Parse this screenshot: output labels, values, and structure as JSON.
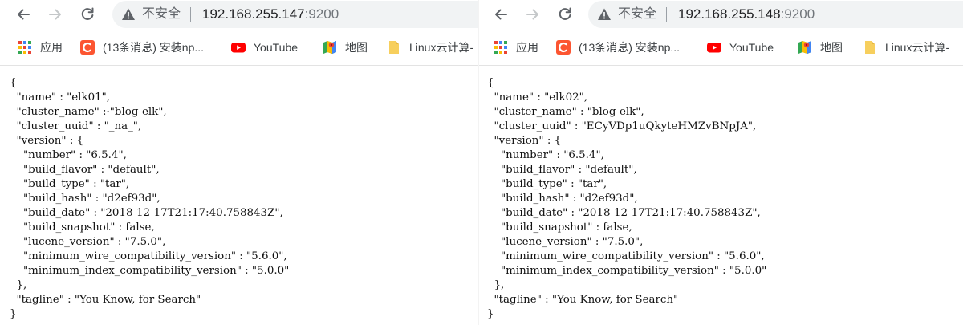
{
  "colors": {
    "toolbar_bg": "#ffffff",
    "omnibox_bg": "#f1f3f4",
    "icon_gray": "#5f6368",
    "disabled_gray": "#c4c7c9",
    "youtube_red": "#ff0000",
    "csdn_orange": "#fc5531",
    "folder_yellow": "#f7cf5d"
  },
  "left": {
    "nav": {
      "back_icon": "back-arrow-icon",
      "forward_icon": "forward-arrow-icon",
      "reload_icon": "reload-icon"
    },
    "address": {
      "security_label": "不安全",
      "host": "192.168.255.147",
      "port": ":9200"
    },
    "bookmarks": [
      {
        "icon": "apps-grid-icon",
        "label": "应用"
      },
      {
        "icon": "csdn-icon",
        "label": "(13条消息) 安装np..."
      },
      {
        "icon": "youtube-icon",
        "label": "YouTube"
      },
      {
        "icon": "maps-icon",
        "label": "地图"
      },
      {
        "icon": "folder-icon",
        "label": "Linux云计算-"
      }
    ],
    "json_body": "{\n  \"name\" : \"elk01\",\n  \"cluster_name\" :·\"blog-elk\",\n  \"cluster_uuid\" : \"_na_\",\n  \"version\" : {\n    \"number\" : \"6.5.4\",\n    \"build_flavor\" : \"default\",\n    \"build_type\" : \"tar\",\n    \"build_hash\" : \"d2ef93d\",\n    \"build_date\" : \"2018-12-17T21:17:40.758843Z\",\n    \"build_snapshot\" : false,\n    \"lucene_version\" : \"7.5.0\",\n    \"minimum_wire_compatibility_version\" : \"5.6.0\",\n    \"minimum_index_compatibility_version\" : \"5.0.0\"\n  },\n  \"tagline\" : \"You Know, for Search\"\n}"
  },
  "right": {
    "nav": {
      "back_icon": "back-arrow-icon",
      "forward_icon": "forward-arrow-icon",
      "reload_icon": "reload-icon"
    },
    "address": {
      "security_label": "不安全",
      "host": "192.168.255.148",
      "port": ":9200"
    },
    "bookmarks": [
      {
        "icon": "apps-grid-icon",
        "label": "应用"
      },
      {
        "icon": "csdn-icon",
        "label": "(13条消息) 安装np..."
      },
      {
        "icon": "youtube-icon",
        "label": "YouTube"
      },
      {
        "icon": "maps-icon",
        "label": "地图"
      },
      {
        "icon": "folder-icon",
        "label": "Linux云计算-"
      }
    ],
    "json_body": "{\n  \"name\" : \"elk02\",\n  \"cluster_name\" : \"blog-elk\",\n  \"cluster_uuid\" : \"ECyVDp1uQkyteHMZvBNpJA\",\n  \"version\" : {\n    \"number\" : \"6.5.4\",\n    \"build_flavor\" : \"default\",\n    \"build_type\" : \"tar\",\n    \"build_hash\" : \"d2ef93d\",\n    \"build_date\" : \"2018-12-17T21:17:40.758843Z\",\n    \"build_snapshot\" : false,\n    \"lucene_version\" : \"7.5.0\",\n    \"minimum_wire_compatibility_version\" : \"5.6.0\",\n    \"minimum_index_compatibility_version\" : \"5.0.0\"\n  },\n  \"tagline\" : \"You Know, for Search\"\n}"
  }
}
